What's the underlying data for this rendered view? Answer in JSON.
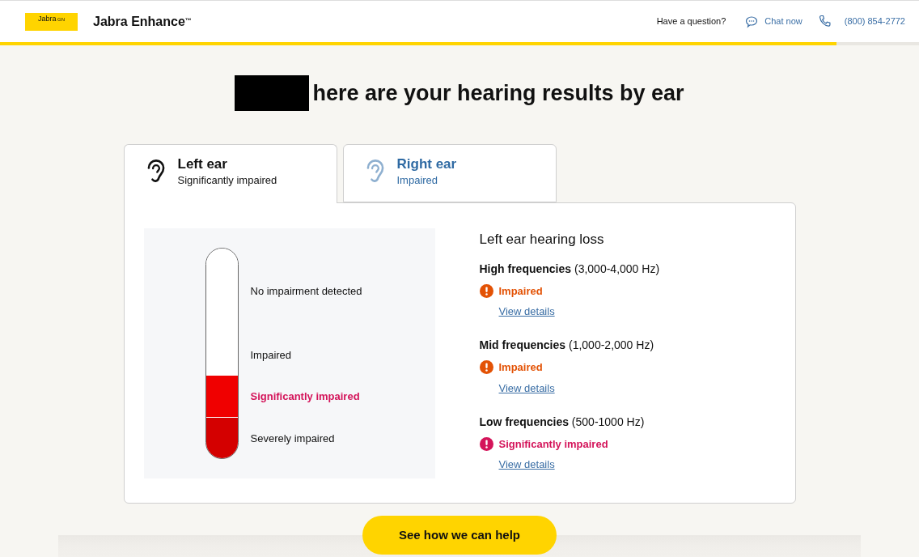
{
  "header": {
    "brand": "Jabra Enhance",
    "trademark": "™",
    "logo_text": "Jabra",
    "logo_sup": "GN",
    "question": "Have a question?",
    "chat": "Chat now",
    "phone": "(800) 854-2772",
    "progress": {
      "level": 0.91
    }
  },
  "heading": {
    "redacted": true,
    "text": "here are your hearing results by ear"
  },
  "tabs": [
    {
      "title": "Left ear",
      "subtitle": "Significantly impaired",
      "selected": true
    },
    {
      "title": "Right ear",
      "subtitle": "Impaired",
      "selected": false
    }
  ],
  "meter": {
    "levels": [
      {
        "label": "No impairment detected",
        "selected": false,
        "color": "#ffffff"
      },
      {
        "label": "Impaired",
        "selected": false,
        "color": "#ffffff"
      },
      {
        "label": "Significantly impaired",
        "selected": true,
        "color": "#f00000"
      },
      {
        "label": "Severely impaired",
        "selected": false,
        "color": "#d40000"
      }
    ]
  },
  "summary": {
    "title": "Left ear hearing loss",
    "frequencies": [
      {
        "name": "High frequencies",
        "range": "(3,000-4,000 Hz)",
        "status": "Impaired",
        "kind": "impaired",
        "link": "View details"
      },
      {
        "name": "Mid frequencies",
        "range": "(1,000-2,000 Hz)",
        "status": "Impaired",
        "kind": "impaired",
        "link": "View details"
      },
      {
        "name": "Low frequencies",
        "range": "(500-1000 Hz)",
        "status": "Significantly impaired",
        "kind": "significant",
        "link": "View details"
      }
    ]
  },
  "cta": "See how we can help"
}
